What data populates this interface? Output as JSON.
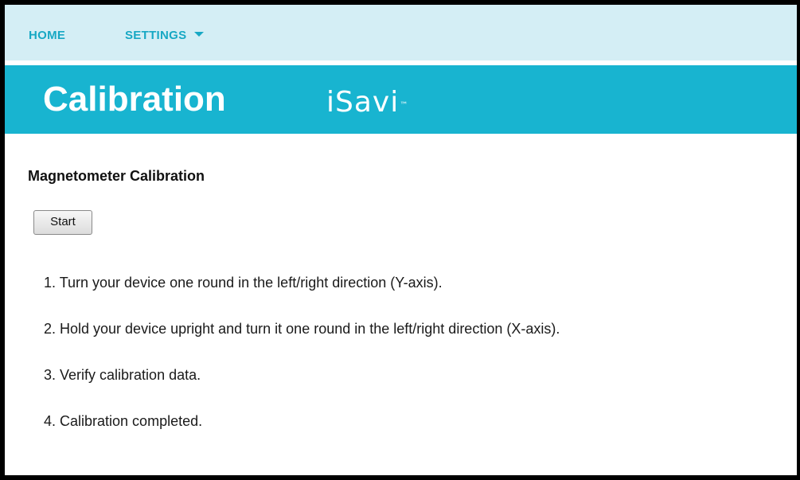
{
  "nav": {
    "home_label": "HOME",
    "settings_label": "SETTINGS",
    "settings_icon": "chevron-down-icon"
  },
  "banner": {
    "title": "Calibration",
    "logo_text": "iSavi",
    "logo_mark": "™"
  },
  "main": {
    "section_title": "Magnetometer Calibration",
    "start_button_label": "Start",
    "steps": [
      "1. Turn your device one round in the left/right direction (Y-axis).",
      "2. Hold your device upright and turn it one round in the left/right direction (X-axis).",
      "3. Verify calibration data.",
      "4. Calibration completed."
    ]
  },
  "colors": {
    "nav_background": "#d4eef5",
    "nav_text": "#17a8c4",
    "banner_background": "#18b4d0",
    "banner_text": "#ffffff"
  }
}
